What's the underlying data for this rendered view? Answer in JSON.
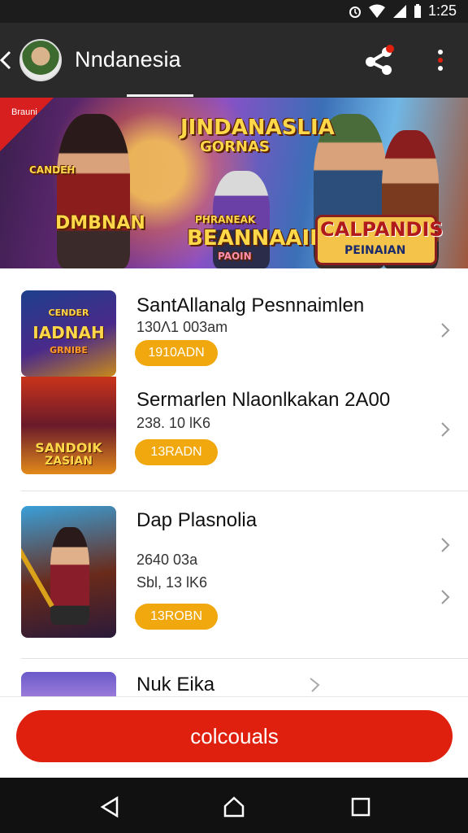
{
  "status_bar": {
    "time": "1:25"
  },
  "app_bar": {
    "title": "Nndanesia"
  },
  "banner": {
    "tag": "Brauni",
    "headline_top": "JINDANASLIA",
    "headline_sub": "GORNAS",
    "left_label": "DMBNAN",
    "left_badge": "CANDEH",
    "center_label": "BEANNAAIK",
    "center_over": "PHRANEAK",
    "center_under": "PAOIN",
    "right_label": "CALPANDIS",
    "right_sub": "PEINAIAN"
  },
  "items": [
    {
      "title": "SantAllanalg Pesnnaimlen",
      "meta": "130Λ1 003am",
      "pill": "1910ADN",
      "thumb_label": "IADNAH",
      "thumb_label_top": "CENDER",
      "thumb_label_bottom": "GRNIBE"
    },
    {
      "title": "Sermarlen Nlaonlkakan 2A00",
      "meta": "238. 10 lK6",
      "pill": "13RADN",
      "thumb_label": "SANDOIK",
      "thumb_label_bottom": "ZASIAN"
    },
    {
      "title": "Dap Plasnolia",
      "meta": "2640 03a",
      "meta2": "Sbl, 13 lK6",
      "pill": "13ROBN"
    },
    {
      "title": "Nuk Eika"
    }
  ],
  "cta": {
    "label": "colcouals"
  },
  "colors": {
    "accent": "#e0200e",
    "pill": "#f0a80e",
    "app_bar": "#2a2a2a"
  }
}
